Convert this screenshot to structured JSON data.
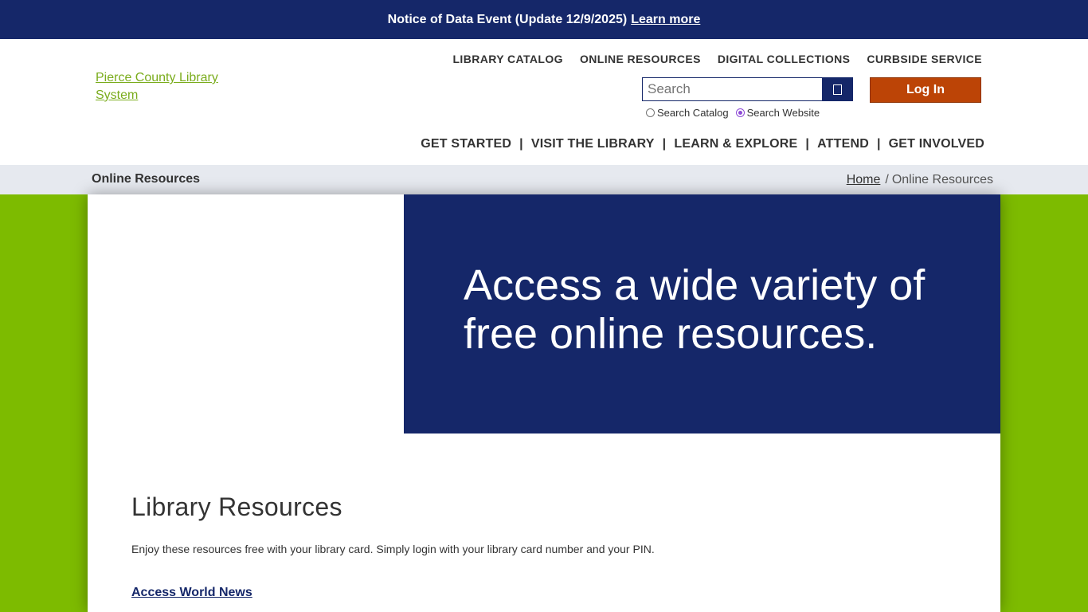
{
  "notice": {
    "text": "Notice of Data Event (Update 12/9/2025)",
    "link": "Learn more"
  },
  "logo": {
    "alt": "Pierce County Library System"
  },
  "top_nav": [
    "LIBRARY CATALOG",
    "ONLINE RESOURCES",
    "DIGITAL COLLECTIONS",
    "CURBSIDE SERVICE"
  ],
  "search": {
    "placeholder": "Search",
    "value": "",
    "options": [
      "Search Catalog",
      "Search Website"
    ],
    "selected": "Search Website"
  },
  "login_label": "Log In",
  "main_nav": [
    "GET STARTED",
    "VISIT THE LIBRARY",
    "LEARN & EXPLORE",
    "ATTEND",
    "GET INVOLVED"
  ],
  "main_nav_separator": "|",
  "breadcrumb_bar": {
    "title": "Online Resources",
    "home": "Home",
    "separator": "/",
    "current": "Online Resources"
  },
  "hero": {
    "text": "Access a wide variety of free online resources."
  },
  "section": {
    "title": "Library Resources",
    "intro": "Enjoy these resources free with your library card. Simply login with your library card number and your PIN.",
    "first_link": "Access World News"
  },
  "colors": {
    "navy": "#152769",
    "green": "#7dbb00",
    "login_orange": "#bc4406",
    "logo_link": "#7aac1c",
    "crumb_bg": "#e6e9ef"
  }
}
